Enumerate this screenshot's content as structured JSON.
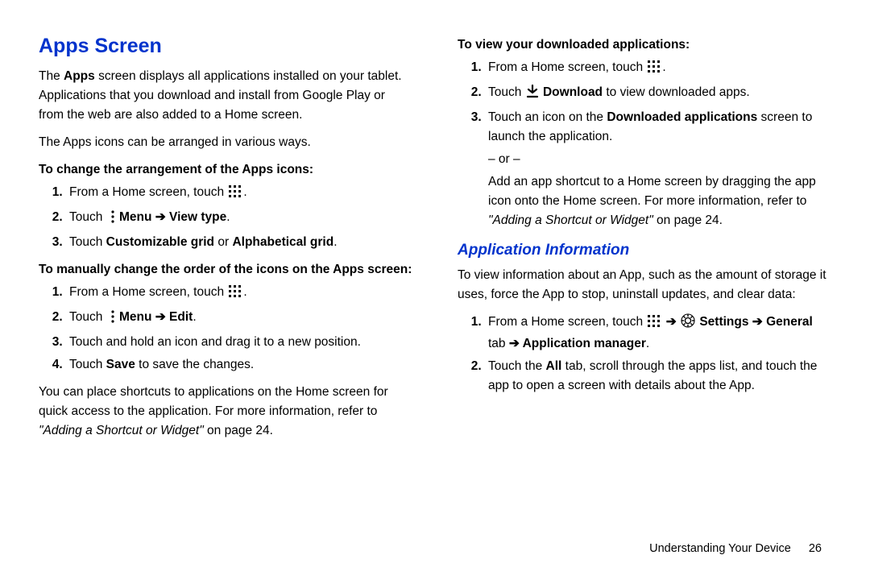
{
  "left": {
    "h2": "Apps Screen",
    "p1a": "The ",
    "p1b": "Apps",
    "p1c": " screen displays all applications installed on your tablet. Applications that you download and install from Google Play or from the web are also added to a Home screen.",
    "p2": "The Apps icons can be arranged in various ways.",
    "lead1": "To change the arrangement of the Apps icons:",
    "s1_1": "From a Home screen, touch ",
    "s1_2a": "Touch ",
    "s1_2b": " Menu ➔ View type",
    "s1_3a": "Touch ",
    "s1_3b": "Customizable grid",
    "s1_3c": " or ",
    "s1_3d": "Alphabetical grid",
    "lead2": "To manually change the order of the icons on the Apps screen:",
    "s2_1": "From a Home screen, touch ",
    "s2_2a": "Touch ",
    "s2_2b": " Menu ➔ Edit",
    "s2_3": "Touch and hold an icon and drag it to a new position.",
    "s2_4a": "Touch ",
    "s2_4b": "Save",
    "s2_4c": " to save the changes.",
    "p3a": "You can place shortcuts to applications on the Home screen for quick access to the application. For more information, refer to ",
    "p3b": "\"Adding a Shortcut or Widget\"",
    "p3c": " on page 24."
  },
  "right": {
    "lead3": "To view your downloaded applications:",
    "s3_1": "From a Home screen, touch ",
    "s3_2a": "Touch ",
    "s3_2b": " Download",
    "s3_2c": " to view downloaded apps.",
    "s3_3a": "Touch an icon on the ",
    "s3_3b": "Downloaded applications",
    "s3_3c": " screen to launch the application.",
    "or": "– or –",
    "s3_or_a": "Add an app shortcut to a Home screen by dragging the app icon onto the Home screen. For more information, refer to ",
    "s3_or_b": "\"Adding a Shortcut or Widget\"",
    "s3_or_c": " on page 24.",
    "h3": "Application Information",
    "p4": "To view information about an App, such as the amount of storage it uses, force the App to stop, uninstall updates, and clear data:",
    "s4_1a": "From a Home screen, touch ",
    "s4_1b": " ➔ ",
    "s4_1c": " Settings ➔ General",
    "s4_1d": " tab ",
    "s4_1e": "➔ Application manager",
    "s4_2a": "Touch the ",
    "s4_2b": "All",
    "s4_2c": " tab, scroll through the apps list, and touch the app to open a screen with details about the App."
  },
  "footer": {
    "label": "Understanding Your Device",
    "page": "26"
  }
}
